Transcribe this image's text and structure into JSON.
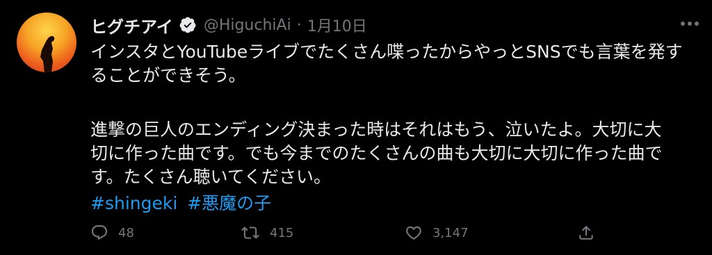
{
  "tweet": {
    "display_name": "ヒグチアイ",
    "handle": "@HiguchiAi",
    "separator": "·",
    "timestamp": "1月10日",
    "lines": [
      "インスタとYouTubeライブでたくさん喋ったからやっとSNSでも言葉を発す",
      "ることができそう。",
      "",
      "進撃の巨人のエンディング決まった時はそれはもう、泣いたよ。大切に大",
      "切に作った曲です。でも今までのたくさんの曲も大切に大切に作った曲で",
      "す。たくさん聴いてください。"
    ],
    "hashtags": [
      "#shingeki",
      "#悪魔の子"
    ]
  },
  "actions": {
    "reply_count": "48",
    "retweet_count": "415",
    "like_count": "3,147"
  },
  "icons": {
    "verified": "verified-badge-icon",
    "more": "more-options-icon",
    "reply": "reply-icon",
    "retweet": "retweet-icon",
    "like": "heart-icon",
    "share": "share-icon"
  },
  "colors": {
    "background": "#000000",
    "text": "#e7e9ea",
    "muted": "#71767b",
    "link": "#1d9bf0",
    "avatar_orange": "#f4801f"
  }
}
